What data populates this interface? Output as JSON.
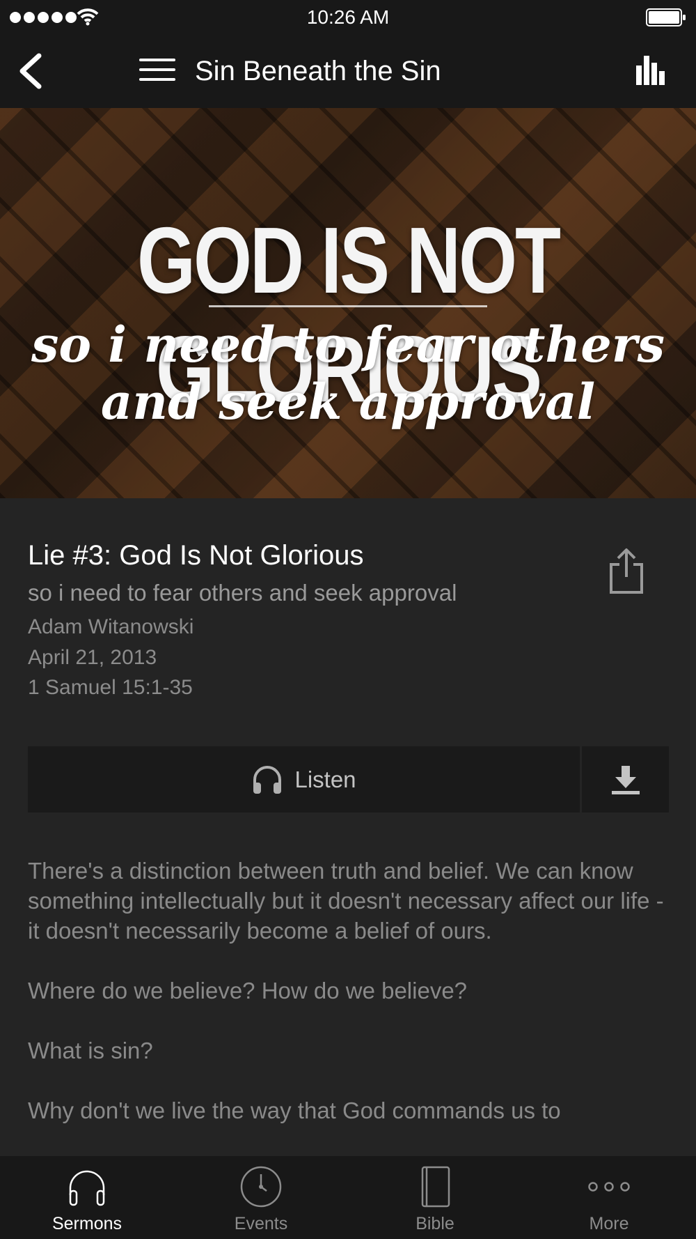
{
  "status_bar": {
    "time": "10:26 AM",
    "icons": [
      "signal-dots-icon",
      "wifi-icon",
      "battery-icon"
    ]
  },
  "nav": {
    "title": "Sin Beneath the Sin",
    "icons": [
      "chevron-left-icon",
      "hamburger-menu-icon",
      "bar-chart-icon"
    ]
  },
  "hero": {
    "headline": "GOD IS NOT GLORIOUS",
    "script_line1": "so i need to fear others",
    "script_line2": "and seek approval"
  },
  "sermon": {
    "title": "Lie #3: God Is Not Glorious",
    "subtitle": "so i need to fear others and seek approval",
    "speaker": "Adam Witanowski",
    "date": "April 21, 2013",
    "passage": "1 Samuel 15:1-35"
  },
  "actions": {
    "listen_label": "Listen",
    "listen_icon": "headphones-icon",
    "download_icon": "download-icon",
    "share_icon": "share-icon"
  },
  "description": {
    "paragraphs": [
      "There's a distinction between truth and belief. We can know something intellectually but it doesn't necessary affect our life - it doesn't necessarily become a belief of ours.",
      "Where do we believe? How do we believe?",
      "What is sin?",
      "Why don't we live the way that God commands us to"
    ]
  },
  "tabs": [
    {
      "label": "Sermons",
      "icon": "headphones-icon",
      "active": true
    },
    {
      "label": "Events",
      "icon": "clock-icon",
      "active": false
    },
    {
      "label": "Bible",
      "icon": "book-icon",
      "active": false
    },
    {
      "label": "More",
      "icon": "more-dots-icon",
      "active": false
    }
  ],
  "colors": {
    "background": "#242424",
    "bars": "#181818",
    "button_bg": "#1a1a1a",
    "active_tab": "#ffffff",
    "inactive": "#8c8c8c"
  }
}
